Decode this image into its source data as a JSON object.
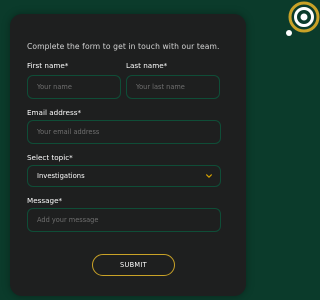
{
  "form": {
    "intro": "Complete the form to get in touch with our team.",
    "first_name": {
      "label": "First name*",
      "placeholder": "Your name"
    },
    "last_name": {
      "label": "Last name*",
      "placeholder": "Your last name"
    },
    "email": {
      "label": "Email address*",
      "placeholder": "Your email address"
    },
    "topic": {
      "label": "Select topic*",
      "value": "Investigations"
    },
    "message": {
      "label": "Message*",
      "placeholder": "Add your message"
    },
    "submit_label": "SUBMIT"
  },
  "colors": {
    "page_background": "#0b3b2b",
    "card_background": "#1e1f1f",
    "field_border": "#0f4d37",
    "accent_gold": "#c9a227",
    "chevron": "#d9a400"
  },
  "icons": {
    "topic_dropdown": "chevron-down-icon",
    "brand": "brand-logo-icon"
  }
}
